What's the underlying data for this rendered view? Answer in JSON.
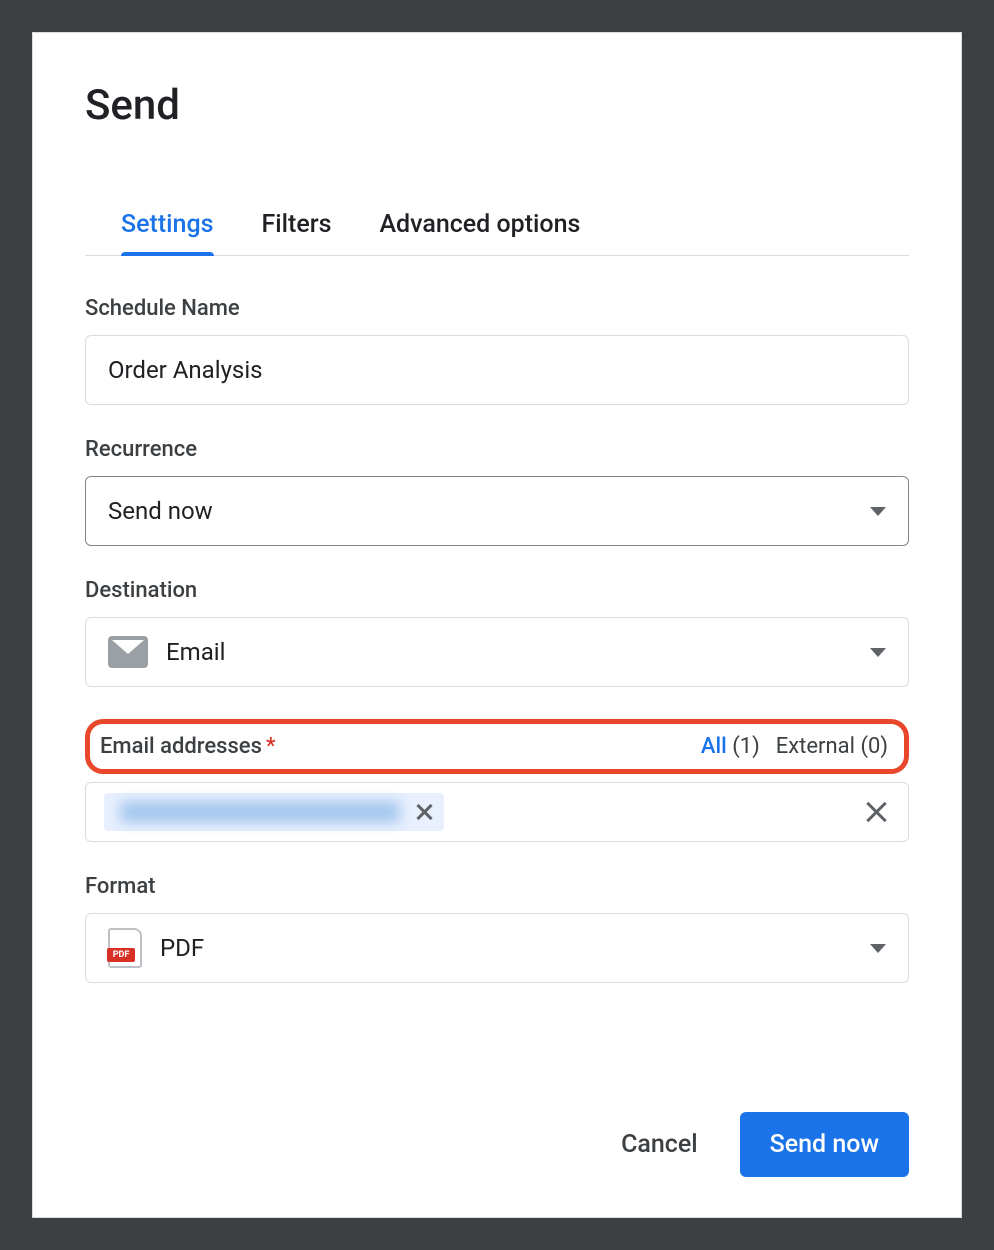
{
  "dialog": {
    "title": "Send"
  },
  "tabs": {
    "settings": "Settings",
    "filters": "Filters",
    "advanced": "Advanced options"
  },
  "fields": {
    "schedule_name": {
      "label": "Schedule Name",
      "value": "Order Analysis"
    },
    "recurrence": {
      "label": "Recurrence",
      "value": "Send now"
    },
    "destination": {
      "label": "Destination",
      "value": "Email"
    },
    "email_addresses": {
      "label": "Email addresses",
      "required_mark": "*",
      "filters": {
        "all": {
          "label": "All",
          "count": "(1)"
        },
        "external": {
          "label": "External",
          "count": "(0)"
        }
      }
    },
    "format": {
      "label": "Format",
      "value": "PDF"
    }
  },
  "footer": {
    "cancel": "Cancel",
    "send_now": "Send now"
  }
}
